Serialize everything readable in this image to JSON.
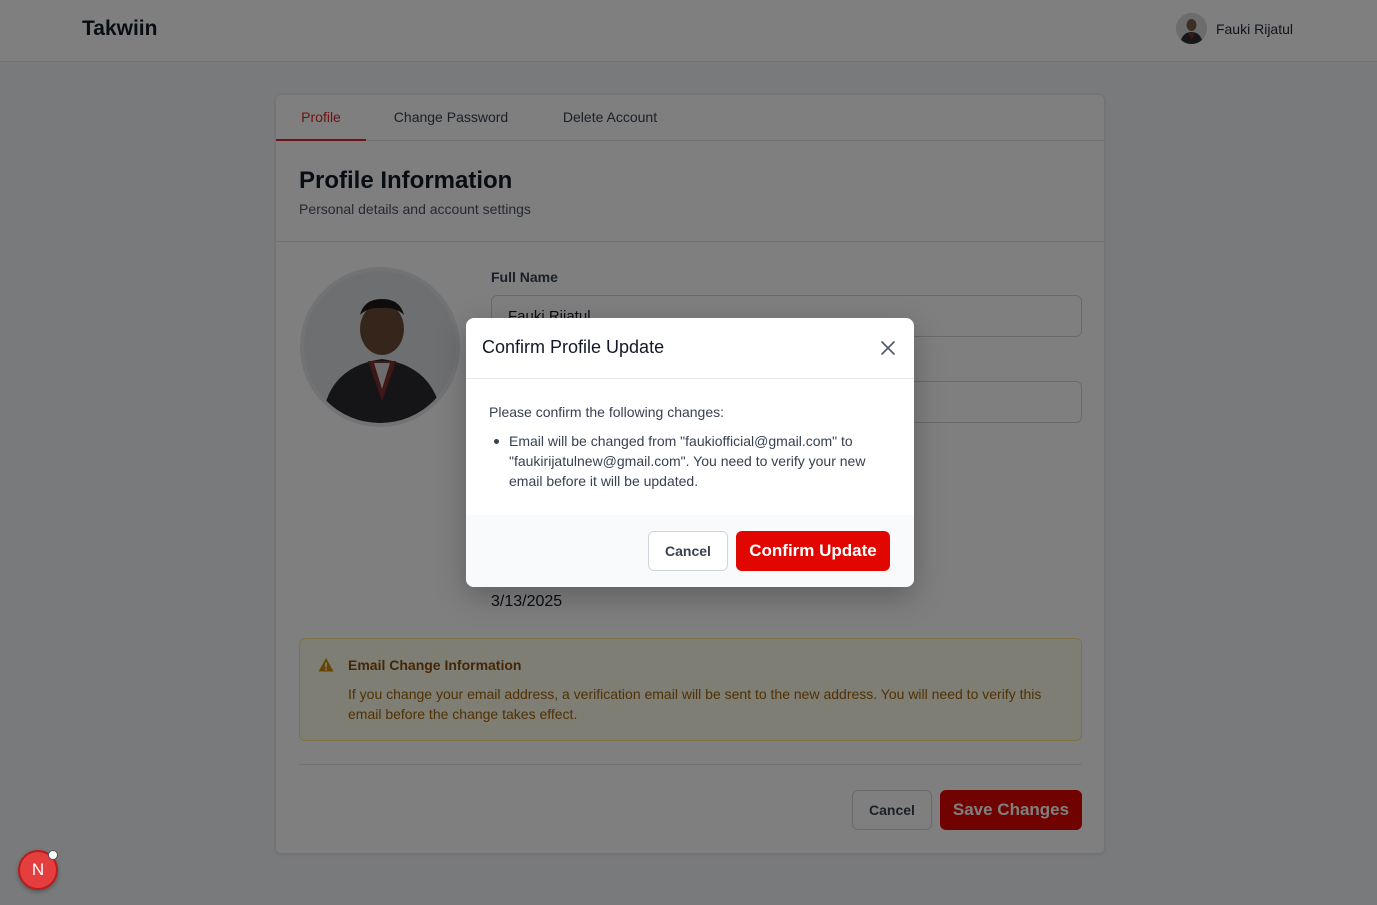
{
  "app": {
    "brand": "Takwiin"
  },
  "user": {
    "name": "Fauki Rijatul"
  },
  "tabs": [
    {
      "label": "Profile",
      "active": true
    },
    {
      "label": "Change Password"
    },
    {
      "label": "Delete Account"
    }
  ],
  "profile": {
    "title": "Profile Information",
    "subtitle": "Personal details and account settings",
    "full_name_label": "Full Name",
    "full_name_value": "Fauki Rijatul",
    "member_since_value": "3/13/2025"
  },
  "notice": {
    "title": "Email Change Information",
    "text": "If you change your email address, a verification email will be sent to the new address. You will need to verify this email before the change takes effect."
  },
  "actions": {
    "cancel_label": "Cancel",
    "save_label": "Save Changes"
  },
  "modal": {
    "title": "Confirm Profile Update",
    "intro": "Please confirm the following changes:",
    "change_item": "Email will be changed from \"faukiofficial@gmail.com\" to \"faukirijatulnew@gmail.com\". You need to verify your new email before it will be updated.",
    "cancel_label": "Cancel",
    "confirm_label": "Confirm Update"
  },
  "dev_badge": {
    "letter": "N"
  },
  "colors": {
    "accent": "#e10600",
    "tab_active": "#dc2626",
    "notice_bg": "#fefce8",
    "notice_text": "#a16207"
  }
}
